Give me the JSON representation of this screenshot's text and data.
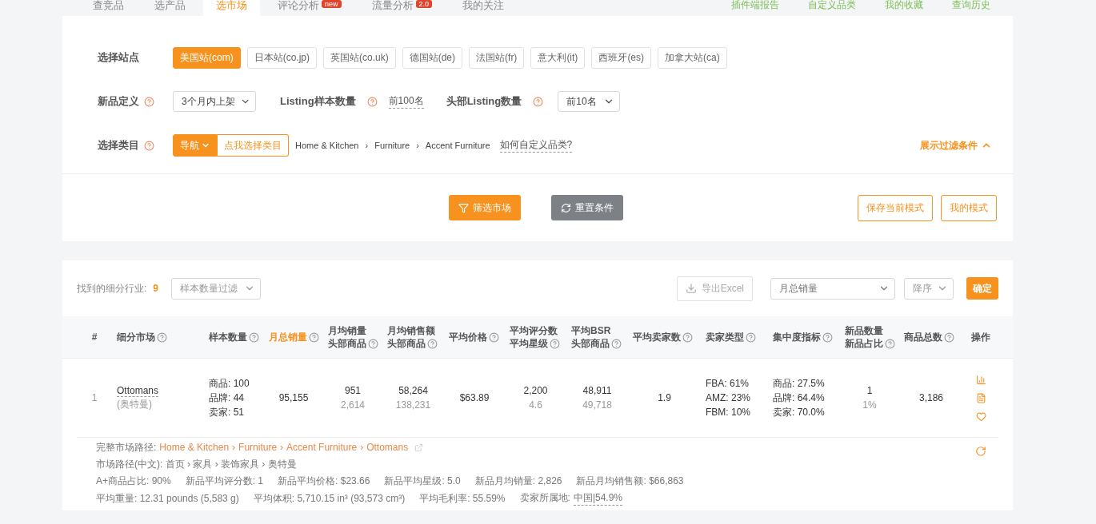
{
  "nav": {
    "tabs": [
      {
        "label": "查竞品",
        "selected": false
      },
      {
        "label": "选产品",
        "selected": false
      },
      {
        "label": "选市场",
        "selected": true
      },
      {
        "label": "评论分析",
        "selected": false,
        "badge": "new"
      },
      {
        "label": "流量分析",
        "selected": false,
        "badge": "2.0"
      },
      {
        "label": "我的关注",
        "selected": false
      }
    ],
    "links": [
      "插件端报告",
      "自定义品类",
      "我的收藏",
      "查询历史"
    ]
  },
  "filters": {
    "site": {
      "label": "选择站点",
      "options": [
        {
          "label": "美国站(com)",
          "selected": true
        },
        {
          "label": "日本站(co.jp)",
          "selected": false
        },
        {
          "label": "英国站(co.uk)",
          "selected": false
        },
        {
          "label": "德国站(de)",
          "selected": false
        },
        {
          "label": "法国站(fr)",
          "selected": false
        },
        {
          "label": "意大利(it)",
          "selected": false
        },
        {
          "label": "西班牙(es)",
          "selected": false
        },
        {
          "label": "加拿大站(ca)",
          "selected": false
        }
      ]
    },
    "new_def": {
      "label": "新品定义",
      "value": "3个月内上架"
    },
    "listing_sample": {
      "label": "Listing样本数量",
      "value": "前100名"
    },
    "head_listing": {
      "label": "头部Listing数量",
      "value": "前10名"
    },
    "category": {
      "label": "选择类目",
      "nav_button": "导航",
      "select_button": "点我选择类目",
      "separator": "›",
      "breadcrumb": [
        "Home & Kitchen",
        "Furniture",
        "Accent Furniture"
      ],
      "custom_link": "如何自定义品类?"
    },
    "toggle": "展示过滤条件"
  },
  "actions": {
    "filter": "筛选市场",
    "reset": "重置条件",
    "save_mode": "保存当前模式",
    "my_mode": "我的模式"
  },
  "results": {
    "found_label": "找到的细分行业:",
    "found_count": "9",
    "sample_filter": "样本数量过滤",
    "export": "导出Excel",
    "sort_field": "月总销量",
    "sort_order": "降序",
    "confirm": "确定"
  },
  "table": {
    "columns": [
      {
        "lines": [
          "#"
        ],
        "help": false,
        "selected": false
      },
      {
        "lines": [
          "细分市场"
        ],
        "help": true,
        "selected": false
      },
      {
        "lines": [
          "样本数量"
        ],
        "help": true,
        "selected": false
      },
      {
        "lines": [
          "月总销量"
        ],
        "help": true,
        "selected": true
      },
      {
        "lines": [
          "月均销量",
          "头部商品"
        ],
        "help": true,
        "selected": false
      },
      {
        "lines": [
          "月均销售额",
          "头部商品"
        ],
        "help": true,
        "selected": false
      },
      {
        "lines": [
          "平均价格"
        ],
        "help": true,
        "selected": false
      },
      {
        "lines": [
          "平均评分数",
          "平均星级"
        ],
        "help": true,
        "selected": false
      },
      {
        "lines": [
          "平均BSR",
          "头部商品"
        ],
        "help": true,
        "selected": false
      },
      {
        "lines": [
          "平均卖家数"
        ],
        "help": true,
        "selected": false
      },
      {
        "lines": [
          "卖家类型"
        ],
        "help": true,
        "selected": false
      },
      {
        "lines": [
          "集中度指标"
        ],
        "help": true,
        "selected": false
      },
      {
        "lines": [
          "新品数量",
          "新品占比"
        ],
        "help": true,
        "selected": false
      },
      {
        "lines": [
          "商品总数"
        ],
        "help": true,
        "selected": false
      },
      {
        "lines": [
          "操作"
        ],
        "help": false,
        "selected": false
      }
    ],
    "rows": [
      {
        "cells": [
          {
            "kind": "index",
            "lines": [
              "1"
            ]
          },
          {
            "kind": "market",
            "lines": [
              "Ottomans",
              "(奥特曼)"
            ]
          },
          {
            "kind": "list",
            "lines": [
              "商品: 100",
              "品牌: 44",
              "卖家: 51"
            ]
          },
          {
            "kind": "pair",
            "lines": [
              "95,155"
            ]
          },
          {
            "kind": "pair",
            "lines": [
              "951",
              "2,614"
            ]
          },
          {
            "kind": "pair",
            "lines": [
              "58,264",
              "138,231"
            ]
          },
          {
            "kind": "pair",
            "lines": [
              "$63.89"
            ]
          },
          {
            "kind": "pair",
            "lines": [
              "2,200",
              "4.6"
            ]
          },
          {
            "kind": "pair",
            "lines": [
              "48,911",
              "49,718"
            ]
          },
          {
            "kind": "pair",
            "lines": [
              "1.9"
            ]
          },
          {
            "kind": "list",
            "lines": [
              "FBA: 61%",
              "AMZ: 23%",
              "FBM: 10%"
            ]
          },
          {
            "kind": "list",
            "lines": [
              "商品: 27.5%",
              "品牌: 64.4%",
              "卖家: 70.0%"
            ]
          },
          {
            "kind": "pair",
            "lines": [
              "1",
              "1%"
            ]
          },
          {
            "kind": "pair",
            "lines": [
              "3,186"
            ]
          },
          {
            "kind": "actions"
          }
        ],
        "detail": {
          "path_label": "完整市场路径:",
          "separator": "›",
          "path": [
            "Home & Kitchen",
            "Furniture",
            "Accent Furniture",
            "Ottomans"
          ],
          "path_cn": "市场路径(中文): 首页 › 家具 › 装饰家具 › 奥特曼",
          "stats": [
            "A+商品占比: 90%",
            "新品平均评分数: 1",
            "新品平均价格: $23.66",
            "新品平均星级: 5.0",
            "新品月均销量: 2,826",
            "新品月均销售额: $66,863"
          ],
          "metrics": [
            "平均重量: 12.31 pounds (5,583 g)",
            "平均体积: 5,710.15 in³ (93,573 cm³)",
            "平均毛利率: 55.59%"
          ],
          "origin_label": "卖家所属地:",
          "origin_value": "中国|54.9%"
        }
      }
    ]
  }
}
